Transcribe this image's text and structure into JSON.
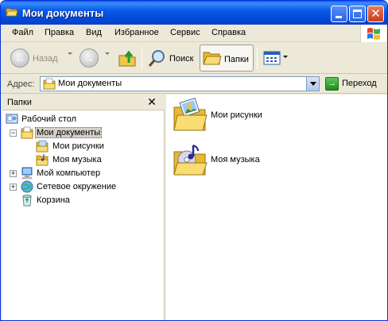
{
  "window": {
    "title": "Мои документы",
    "minimize_label": "",
    "close_glyph": "✕"
  },
  "menu": {
    "items": [
      {
        "label": "Файл"
      },
      {
        "label": "Правка"
      },
      {
        "label": "Вид"
      },
      {
        "label": "Избранное"
      },
      {
        "label": "Сервис"
      },
      {
        "label": "Справка"
      }
    ]
  },
  "toolbar": {
    "back_label": "Назад",
    "search_label": "Поиск",
    "folders_label": "Папки",
    "back_glyph": "←",
    "forward_glyph": "→"
  },
  "address": {
    "label": "Адрес:",
    "value": "Мои документы",
    "go_label": "Переход",
    "go_glyph": "→"
  },
  "folders_pane": {
    "title": "Папки",
    "close_glyph": "✕",
    "tree": [
      {
        "label": "Рабочий стол",
        "icon": "desktop-icon"
      },
      {
        "label": "Мои документы",
        "icon": "my-documents-icon",
        "selected": true,
        "expander": "−"
      },
      {
        "label": "Мои рисунки",
        "icon": "my-pictures-icon"
      },
      {
        "label": "Моя музыка",
        "icon": "my-music-icon"
      },
      {
        "label": "Мой компьютер",
        "icon": "my-computer-icon",
        "expander": "+"
      },
      {
        "label": "Сетевое окружение",
        "icon": "network-icon",
        "expander": "+"
      },
      {
        "label": "Корзина",
        "icon": "recycle-bin-icon"
      }
    ]
  },
  "content": {
    "items": [
      {
        "label": "Мои рисунки",
        "icon": "my-pictures-folder-icon"
      },
      {
        "label": "Моя музыка",
        "icon": "my-music-folder-icon"
      }
    ]
  },
  "colors": {
    "title_bar": "#0a5bea",
    "chrome": "#ece9d8",
    "folder": "#f4d36b"
  }
}
